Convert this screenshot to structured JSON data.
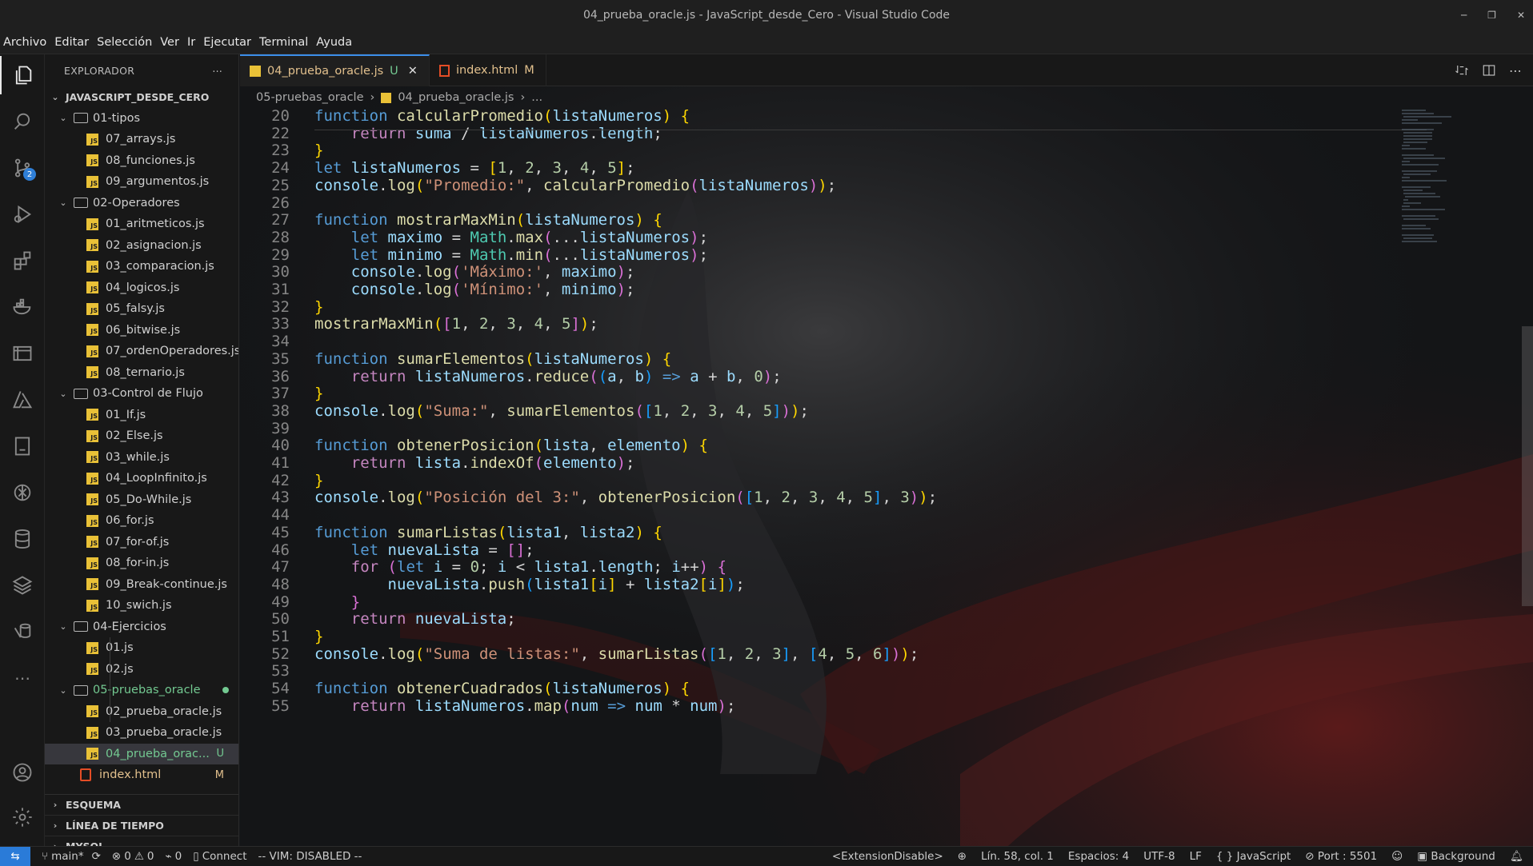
{
  "window": {
    "title": "04_prueba_oracle.js - JavaScript_desde_Cero - Visual Studio Code"
  },
  "menu": [
    "Archivo",
    "Editar",
    "Selección",
    "Ver",
    "Ir",
    "Ejecutar",
    "Terminal",
    "Ayuda"
  ],
  "activity": {
    "scm_badge": "2"
  },
  "explorer": {
    "title": "EXPLORADOR",
    "root": "JAVASCRIPT_DESDE_CERO",
    "folders": {
      "f01": "01-tipos",
      "f02": "02-Operadores",
      "f03": "03-Control de Flujo",
      "f04": "04-Ejercicios",
      "f05": "05-pruebas_oracle"
    },
    "files": [
      "07_arrays.js",
      "08_funciones.js",
      "09_argumentos.js",
      "01_aritmeticos.js",
      "02_asignacion.js",
      "03_comparacion.js",
      "04_logicos.js",
      "05_falsy.js",
      "06_bitwise.js",
      "07_ordenOperadores.js",
      "08_ternario.js",
      "01_If.js",
      "02_Else.js",
      "03_while.js",
      "04_LoopInfinito.js",
      "05_Do-While.js",
      "06_for.js",
      "07_for-of.js",
      "08_for-in.js",
      "09_Break-continue.js",
      "10_swich.js",
      "01.js",
      "02.js",
      "02_prueba_oracle.js",
      "03_prueba_oracle.js",
      "04_prueba_orac...",
      "index.html"
    ],
    "status": {
      "untracked": "U",
      "modified": "M"
    },
    "sections": [
      "ESQUEMA",
      "LÍNEA DE TIEMPO",
      "MYSQL"
    ]
  },
  "tabs": [
    {
      "label": "04_prueba_oracle.js",
      "status": "U"
    },
    {
      "label": "index.html",
      "status": "M"
    }
  ],
  "breadcrumb": {
    "folder": "05-pruebas_oracle",
    "file": "04_prueba_oracle.js",
    "more": "..."
  },
  "editor": {
    "line_numbers": [
      "20",
      "22",
      "23",
      "24",
      "25",
      "26",
      "27",
      "28",
      "29",
      "30",
      "31",
      "32",
      "33",
      "34",
      "35",
      "36",
      "37",
      "38",
      "39",
      "40",
      "41",
      "42",
      "43",
      "44",
      "45",
      "46",
      "47",
      "48",
      "49",
      "50",
      "51",
      "52",
      "53",
      "54",
      "55"
    ]
  },
  "statusbar": {
    "branch": "main*",
    "errors": "0",
    "warnings": "0",
    "ports": "0",
    "connect": "Connect",
    "vim": "-- VIM: DISABLED --",
    "ext": "<ExtensionDisable>",
    "position": "Lín. 58, col. 1",
    "spaces": "Espacios: 4",
    "encoding": "UTF-8",
    "eol": "LF",
    "language": "JavaScript",
    "port": "Port : 5501",
    "background": "Background"
  },
  "colors": {
    "accent": "#2a7bd8",
    "keyword": "#569cd6",
    "function": "#dcdcaa",
    "variable": "#9cdcfe",
    "string": "#ce9178",
    "number": "#b5cea8",
    "js_icon": "#e9c137",
    "html_icon": "#e44d26",
    "modified": "#e2c08d",
    "untracked": "#73c991"
  }
}
